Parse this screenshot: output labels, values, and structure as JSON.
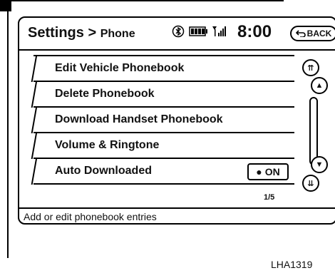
{
  "header": {
    "title_main": "Settings >",
    "title_sub": "Phone",
    "clock": "8:00",
    "back_label": "BACK"
  },
  "status_icons": [
    "bluetooth-icon",
    "battery-icon",
    "signal-icon"
  ],
  "list": {
    "items": [
      {
        "label": "Edit Vehicle Phonebook"
      },
      {
        "label": "Delete Phonebook"
      },
      {
        "label": "Download Handset Phonebook"
      },
      {
        "label": "Volume & Ringtone"
      },
      {
        "label": "Auto Downloaded",
        "toggle": "ON"
      }
    ],
    "page_count": "1/5"
  },
  "footer": {
    "help_text": "Add or edit phonebook entries"
  },
  "figure_code": "LHA1319"
}
